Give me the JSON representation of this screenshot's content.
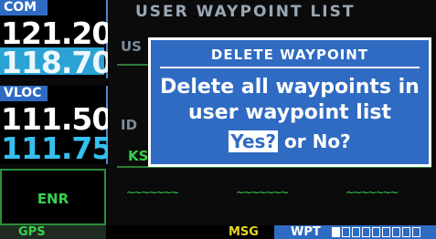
{
  "com": {
    "tag": "COM",
    "active_freq": "121.200",
    "standby_freq": "118.700"
  },
  "vloc": {
    "tag": "VLOC",
    "active_freq": "111.50",
    "standby_freq": "111.75"
  },
  "nav_mode": "ENR",
  "background_page": {
    "title": "USER WAYPOINT LIST",
    "partial_us": "US",
    "partial_id": "ID",
    "partial_ks": "KS"
  },
  "dialog": {
    "title": "DELETE WAYPOINT",
    "message_line1": "Delete all waypoints in",
    "message_line2": "user waypoint list",
    "yes_label": "Yes?",
    "or_label": "or",
    "no_label": "No?"
  },
  "bottom_bar": {
    "mode": "GPS",
    "msg": "MSG",
    "page_group": "WPT"
  },
  "colors": {
    "accent_blue": "#2f6bc2",
    "nav_green": "#37d24d",
    "msg_yellow": "#e8d623",
    "standby_cyan": "#35c0ef"
  }
}
